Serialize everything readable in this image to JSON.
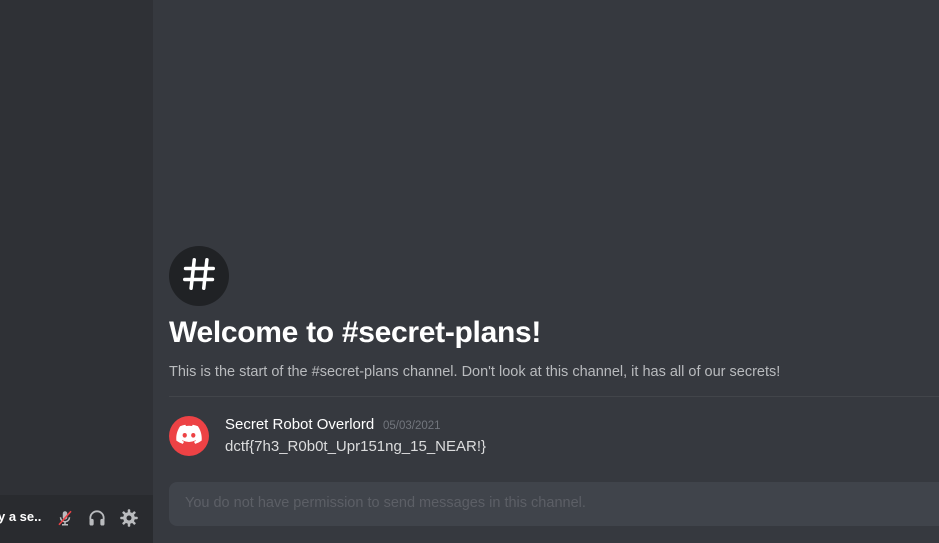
{
  "user_panel": {
    "status_text": "y a se...",
    "mute_icon": "muted-microphone-icon",
    "deafen_icon": "headphones-icon",
    "settings_icon": "gear-icon"
  },
  "channel": {
    "welcome_title": "Welcome to #secret-plans!",
    "welcome_description": "This is the start of the #secret-plans channel. Don't look at this channel, it has all of our secrets!",
    "hash_icon": "hash-icon"
  },
  "messages": [
    {
      "author": "Secret Robot Overlord",
      "timestamp": "05/03/2021",
      "content": "dctf{7h3_R0b0t_Upr151ng_15_NEAR!}",
      "avatar_icon": "discord-logo-icon"
    }
  ],
  "composer": {
    "placeholder": "You do not have permission to send messages in this channel."
  },
  "colors": {
    "sidebar": "#2f3136",
    "user_panel": "#292b2f",
    "main": "#36393f",
    "avatar": "#ed4245",
    "muted_red": "#ed4245"
  }
}
